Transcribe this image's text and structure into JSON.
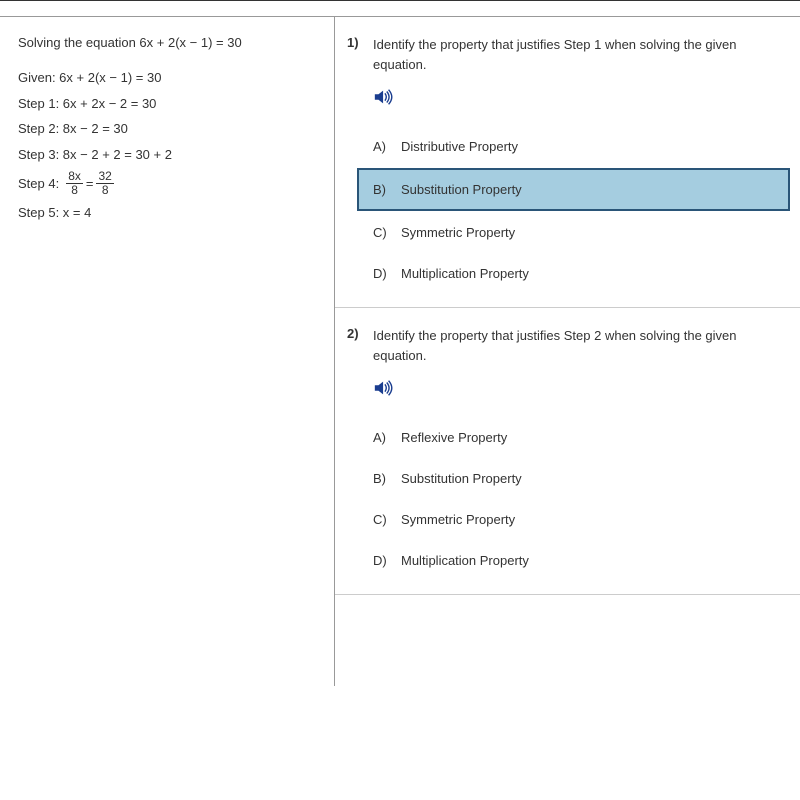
{
  "leftPanel": {
    "title": "Solving the equation 6x + 2(x − 1) = 30",
    "given": "Given: 6x + 2(x − 1) = 30",
    "step1": "Step 1: 6x + 2x − 2 = 30",
    "step2": "Step 2: 8x − 2 = 30",
    "step3": "Step 3: 8x − 2 + 2 = 30 + 2",
    "step4Label": "Step 4:",
    "step4Frac1Num": "8x",
    "step4Frac1Den": "8",
    "step4Eq": "=",
    "step4Frac2Num": "32",
    "step4Frac2Den": "8",
    "step5": "Step 5: x = 4"
  },
  "questions": [
    {
      "number": "1)",
      "text": "Identify the property that justifies Step 1 when solving the given equation.",
      "choices": [
        {
          "letter": "A)",
          "text": "Distributive Property",
          "selected": false
        },
        {
          "letter": "B)",
          "text": "Substitution Property",
          "selected": true
        },
        {
          "letter": "C)",
          "text": "Symmetric Property",
          "selected": false
        },
        {
          "letter": "D)",
          "text": "Multiplication Property",
          "selected": false
        }
      ]
    },
    {
      "number": "2)",
      "text": "Identify the property that justifies Step 2 when solving the given equation.",
      "choices": [
        {
          "letter": "A)",
          "text": "Reflexive Property",
          "selected": false
        },
        {
          "letter": "B)",
          "text": "Substitution Property",
          "selected": false
        },
        {
          "letter": "C)",
          "text": "Symmetric Property",
          "selected": false
        },
        {
          "letter": "D)",
          "text": "Multiplication Property",
          "selected": false
        }
      ]
    }
  ]
}
